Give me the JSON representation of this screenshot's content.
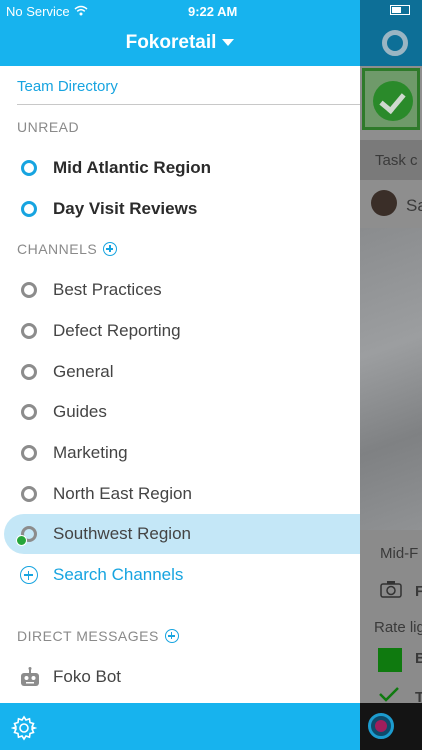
{
  "status": {
    "carrier": "No Service",
    "time": "9:22 AM"
  },
  "header": {
    "title": "Fokoretail"
  },
  "team_directory": "Team Directory",
  "sections": {
    "unread": "UNREAD",
    "channels": "CHANNELS",
    "direct": "DIRECT MESSAGES"
  },
  "unread": [
    {
      "label": "Mid Atlantic Region"
    },
    {
      "label": "Day Visit Reviews"
    }
  ],
  "channels": [
    {
      "label": "Best Practices"
    },
    {
      "label": "Defect Reporting"
    },
    {
      "label": "General"
    },
    {
      "label": "Guides"
    },
    {
      "label": "Marketing"
    },
    {
      "label": "North East Region"
    },
    {
      "label": "Southwest Region",
      "selected": true
    }
  ],
  "search_channels": "Search Channels",
  "direct_messages": [
    {
      "label": "Foko Bot"
    }
  ],
  "right_pane": {
    "task_prefix": "Task c",
    "user_prefix": "Sa",
    "region_prefix": "Mid-F",
    "rate_prefix": "Rate lig",
    "row_f": "F",
    "row_b": "B",
    "row_t": "T"
  },
  "colors": {
    "accent": "#17b3ee",
    "link": "#17a4e0",
    "selected_bg": "#c4e7f7",
    "online": "#27a63b"
  }
}
